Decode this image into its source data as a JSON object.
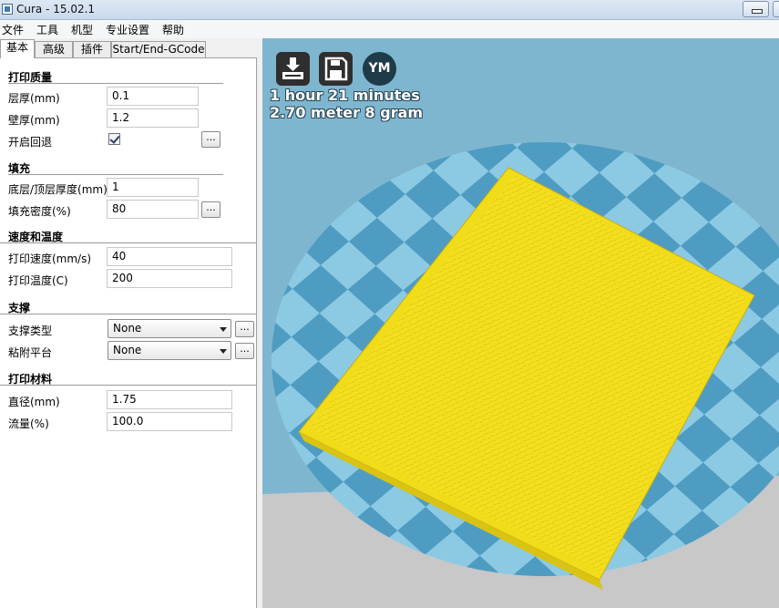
{
  "window": {
    "title": "Cura - 15.02.1"
  },
  "menu": [
    "文件",
    "工具",
    "机型",
    "专业设置",
    "帮助"
  ],
  "tabs": [
    "基本",
    "高级",
    "插件",
    "Start/End-GCode"
  ],
  "sections": {
    "quality": {
      "title": "打印质量",
      "layer_height_label": "层厚(mm)",
      "layer_height": "0.1",
      "shell_label": "壁厚(mm)",
      "shell": "1.2",
      "retraction_label": "开启回退",
      "retraction_checked": true
    },
    "fill": {
      "title": "填充",
      "bottom_top_label": "底层/顶层厚度(mm)",
      "bottom_top": "1",
      "density_label": "填充密度(%)",
      "density": "80"
    },
    "speed_temp": {
      "title": "速度和温度",
      "speed_label": "打印速度(mm/s)",
      "speed": "40",
      "temp_label": "打印温度(C)",
      "temp": "200"
    },
    "support": {
      "title": "支撑",
      "type_label": "支撑类型",
      "type_value": "None",
      "adhesion_label": "粘附平台",
      "adhesion_value": "None"
    },
    "filament": {
      "title": "打印材料",
      "diameter_label": "直径(mm)",
      "diameter": "1.75",
      "flow_label": "流量(%)",
      "flow": "100.0"
    }
  },
  "more_button_label": "...",
  "viewport": {
    "toolbar": {
      "ym_label": "YM"
    },
    "estimate_time": "1 hour 21 minutes",
    "estimate_material": "2.70 meter 8 gram"
  },
  "colors": {
    "model": "#f5e21f",
    "platform_light": "#8ccae3",
    "platform_dark": "#4f9cc2",
    "background": "#7fb6cf"
  }
}
